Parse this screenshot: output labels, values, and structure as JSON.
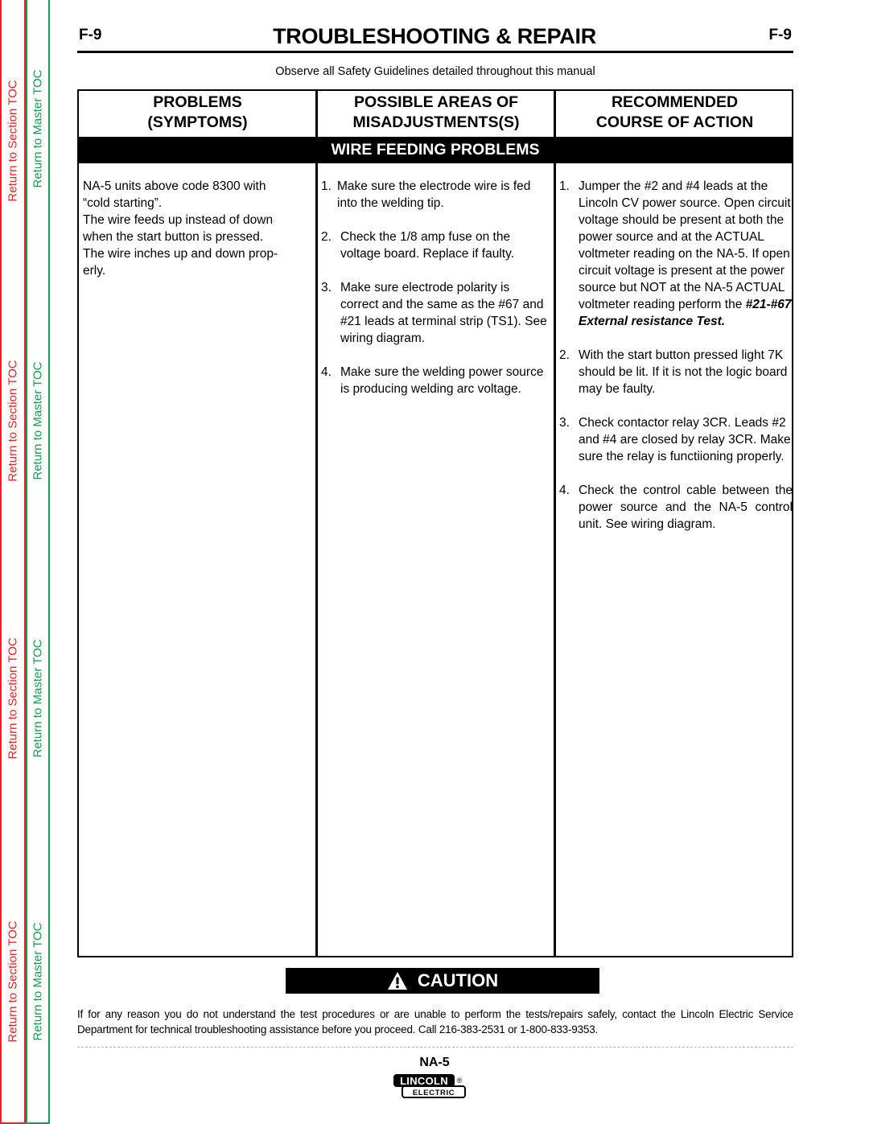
{
  "toc": {
    "section_label": "Return to Section TOC",
    "master_label": "Return to Master TOC",
    "colors": {
      "section": "#e8232f",
      "master": "#1a9a53"
    }
  },
  "header": {
    "page_id": "F-9",
    "title": "TROUBLESHOOTING & REPAIR",
    "safety_note": "Observe all Safety Guidelines detailed throughout this manual"
  },
  "table": {
    "columns": [
      {
        "line1": "PROBLEMS",
        "line2": "(SYMPTOMS)"
      },
      {
        "line1": "POSSIBLE AREAS OF",
        "line2": "MISADJUSTMENTS(S)"
      },
      {
        "line1": "RECOMMENDED",
        "line2": "COURSE OF ACTION"
      }
    ],
    "section": "WIRE FEEDING PROBLEMS",
    "problem": {
      "lines": [
        "NA-5 units above code 8300 with",
        "“cold starting”.",
        "The wire feeds up instead of down",
        "when the start button is pressed.",
        "The wire inches up and down prop-",
        "erly."
      ]
    },
    "misadjustments": [
      {
        "num": "1.",
        "text": "Make sure the electrode wire is fed into the welding tip."
      },
      {
        "num": "2.",
        "text": "Check the 1/8 amp fuse on the voltage board.  Replace if faulty."
      },
      {
        "num": "3.",
        "text": "Make sure electrode polarity is correct and the same as the #67 and #21 leads at terminal strip (TS1).  See wiring diagram."
      },
      {
        "num": "4.",
        "text": "Make sure the welding power source is producing welding arc voltage."
      }
    ],
    "actions": [
      {
        "num": "1.",
        "text": "Jumper the #2 and #4 leads at the Lincoln CV power source. Open circuit voltage should be present at both the power source and at the ACTUAL voltmeter reading on the NA-5.  If open circuit voltage is present at the power source but NOT at the NA-5 ACTUAL voltmeter reading perform the",
        "emphasis": "#21-#67 External resistance Test."
      },
      {
        "num": "2.",
        "text": "With the start button pressed light 7K should be lit.  If it is not the logic board may be faulty."
      },
      {
        "num": "3.",
        "text": "Check contactor relay 3CR. Leads #2 and #4 are closed by relay 3CR.  Make sure the relay is functiioning properly."
      },
      {
        "num": "4.",
        "text": "Check the control cable between the power source and the NA-5 control unit.  See wiring diagram."
      }
    ]
  },
  "caution": {
    "label": "CAUTION",
    "icon": "warning-triangle-icon",
    "text": "If for any reason you do not understand the test procedures or are unable to perform the tests/repairs safely, contact the Lincoln Electric Service Department for technical troubleshooting assistance before you proceed. Call 216-383-2531 or 1-800-833-9353."
  },
  "footer": {
    "model": "NA-5",
    "logo_top": "LINCOLN",
    "logo_bottom": "ELECTRIC",
    "logo_mark": "®"
  }
}
